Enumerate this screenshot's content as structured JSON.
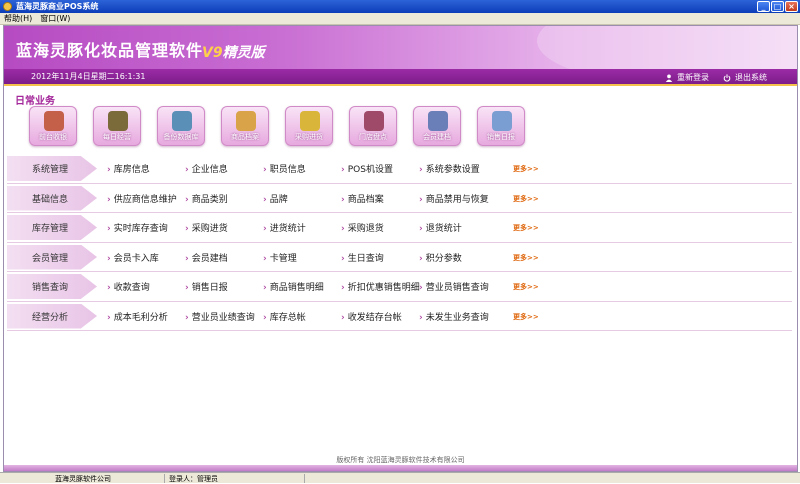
{
  "window": {
    "title": "蓝海灵豚商业POS系统",
    "min": "_",
    "max": "□",
    "close": "×"
  },
  "menu": [
    "帮助(H)",
    "窗口(W)"
  ],
  "banner": {
    "brand": "蓝海灵豚化妆品管理软件",
    "version_v": "V9",
    "version_text": "精灵版"
  },
  "datebar": {
    "datetime": "2012年11月4日星期二16:1:31",
    "relogin": "重新登录",
    "exit": "退出系统"
  },
  "section": "日常业务",
  "quick": [
    {
      "label": "前台收银",
      "color": "#c45f4a"
    },
    {
      "label": "每日经营",
      "color": "#7b6a3a"
    },
    {
      "label": "备份数据库",
      "color": "#5a8fb8"
    },
    {
      "label": "商品档案",
      "color": "#d9a34a"
    },
    {
      "label": "采购进货",
      "color": "#d9b63a"
    },
    {
      "label": "门店盘点",
      "color": "#a04a6a"
    },
    {
      "label": "会员建档",
      "color": "#6a7fb8"
    },
    {
      "label": "销售日报",
      "color": "#7a9ed1"
    }
  ],
  "rows": [
    {
      "cat": "系统管理",
      "items": [
        "库房信息",
        "企业信息",
        "职员信息",
        "POS机设置",
        "系统参数设置"
      ],
      "more": "更多>>"
    },
    {
      "cat": "基础信息",
      "items": [
        "供应商信息维护",
        "商品类别",
        "品牌",
        "商品档案",
        "商品禁用与恢复"
      ],
      "more": "更多>>"
    },
    {
      "cat": "库存管理",
      "items": [
        "实时库存查询",
        "采购进货",
        "进货统计",
        "采购退货",
        "退货统计"
      ],
      "more": "更多>>"
    },
    {
      "cat": "会员管理",
      "items": [
        "会员卡入库",
        "会员建档",
        "卡管理",
        "生日查询",
        "积分参数"
      ],
      "more": "更多>>"
    },
    {
      "cat": "销售查询",
      "items": [
        "收款查询",
        "销售日报",
        "商品销售明细",
        "折扣优惠销售明细",
        "营业员销售查询"
      ],
      "more": "更多>>"
    },
    {
      "cat": "经营分析",
      "items": [
        "成本毛利分析",
        "营业员业绩查询",
        "库存总帐",
        "收发结存台帐",
        "未发生业务查询"
      ],
      "more": "更多>>"
    }
  ],
  "footer": "版权所有  沈阳蓝海灵豚软件技术有限公司",
  "status": {
    "company": "蓝海灵豚软件公司",
    "user": "登录人：管理员"
  }
}
